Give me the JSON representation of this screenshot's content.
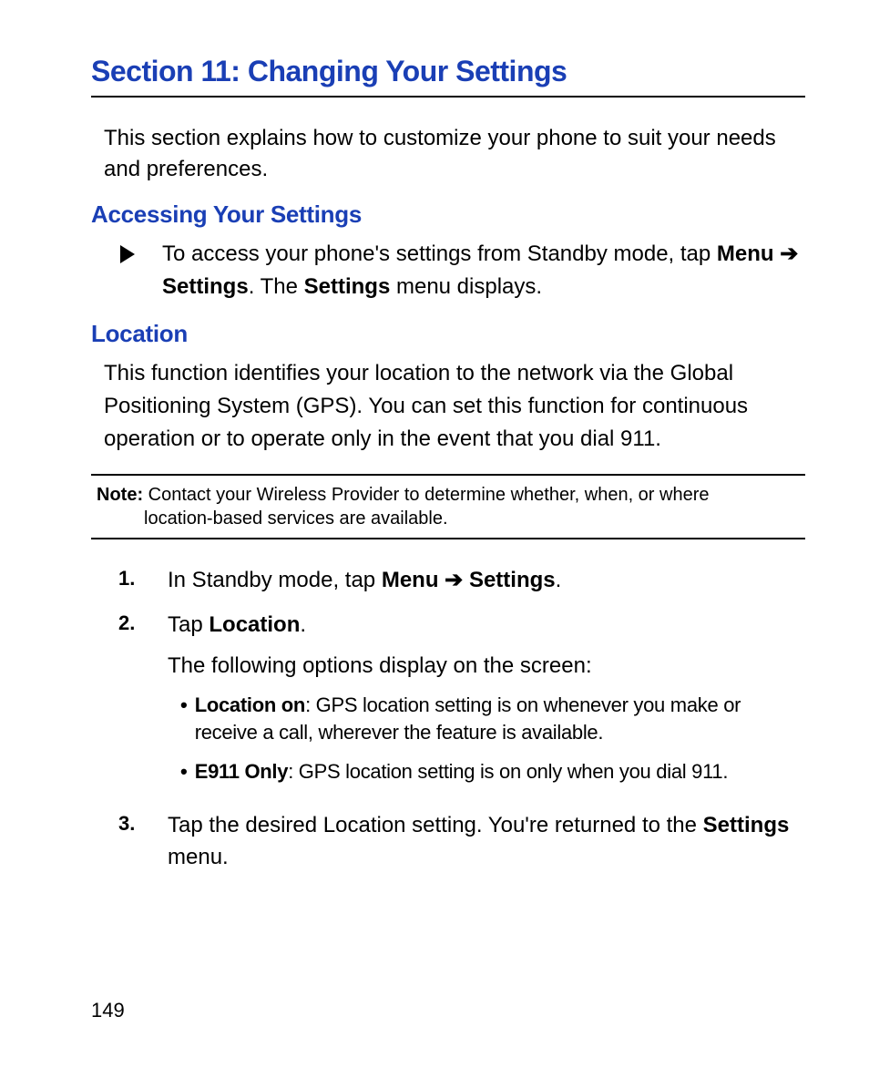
{
  "title": "Section 11: Changing Your Settings",
  "intro": "This section explains how to customize your phone to suit your needs and preferences.",
  "sub1": {
    "heading": "Accessing Your Settings",
    "arrow_pre": "To access your phone's settings from Standby mode, tap ",
    "arrow_menu": "Menu",
    "arrow_sym": "➔",
    "arrow_settings": "Settings",
    "arrow_post1": ". The ",
    "arrow_settings2": "Settings",
    "arrow_post2": " menu displays."
  },
  "sub2": {
    "heading": "Location",
    "para": "This function identifies your location to the network via the Global Positioning System (GPS). You can set this function for continuous operation or to operate only in the event that you dial 911."
  },
  "note": {
    "label": "Note:",
    "line1": " Contact your Wireless Provider to determine whether, when, or where",
    "line2": "location-based services are available."
  },
  "steps": {
    "n1": "1.",
    "s1_pre": "In Standby mode, tap ",
    "s1_menu": "Menu",
    "s1_sym": "➔",
    "s1_settings": "Settings",
    "s1_post": ".",
    "n2": "2.",
    "s2_pre": "Tap ",
    "s2_loc": "Location",
    "s2_post": ".",
    "s2_sub": "The following options display on the screen:",
    "b1_label": "Location on",
    "b1_text": ": GPS location setting is on whenever you make or receive a call, wherever the feature is available.",
    "b2_label": "E911 Only",
    "b2_text": ": GPS location setting is on only when you dial 911.",
    "n3": "3.",
    "s3_pre": "Tap the desired Location setting. You're returned to the ",
    "s3_settings": "Settings",
    "s3_post": " menu."
  },
  "bullet": "•",
  "page": "149"
}
